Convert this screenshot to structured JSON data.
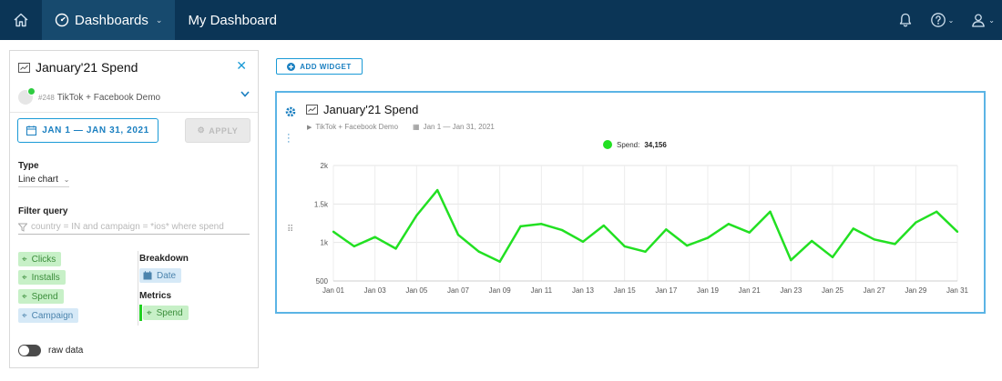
{
  "nav": {
    "dashboards_label": "Dashboards",
    "page_title": "My Dashboard"
  },
  "panel": {
    "title": "January'21 Spend",
    "source_id": "#248",
    "source_name": "TikTok + Facebook Demo",
    "date_range": "JAN 1 — JAN 31, 2021",
    "apply_label": "APPLY",
    "type_label": "Type",
    "type_value": "Line chart",
    "filter_label": "Filter query",
    "filter_placeholder": "country = IN and campaign = *ios* where spend",
    "fields": [
      {
        "label": "Clicks",
        "kind": "metric"
      },
      {
        "label": "Installs",
        "kind": "metric"
      },
      {
        "label": "Spend",
        "kind": "metric"
      },
      {
        "label": "Campaign",
        "kind": "dimension"
      }
    ],
    "breakdown_label": "Breakdown",
    "breakdown_value": "Date",
    "metrics_label": "Metrics",
    "metrics_value": "Spend",
    "raw_data_label": "raw data"
  },
  "toolbar": {
    "add_widget_label": "ADD WIDGET"
  },
  "widget": {
    "title": "January'21 Spend",
    "source": "TikTok + Facebook Demo",
    "date_range": "Jan 1 — Jan 31, 2021",
    "legend_label": "Spend:",
    "legend_total": "34,156"
  },
  "colors": {
    "series": "#22e022",
    "accent": "#1a9ad6",
    "nav_bg": "#0b3556"
  },
  "chart_data": {
    "type": "line",
    "x": [
      "Jan 01",
      "Jan 02",
      "Jan 03",
      "Jan 04",
      "Jan 05",
      "Jan 06",
      "Jan 07",
      "Jan 08",
      "Jan 09",
      "Jan 10",
      "Jan 11",
      "Jan 12",
      "Jan 13",
      "Jan 14",
      "Jan 15",
      "Jan 16",
      "Jan 17",
      "Jan 18",
      "Jan 19",
      "Jan 20",
      "Jan 21",
      "Jan 22",
      "Jan 23",
      "Jan 24",
      "Jan 25",
      "Jan 26",
      "Jan 27",
      "Jan 28",
      "Jan 29",
      "Jan 30",
      "Jan 31"
    ],
    "x_tick_labels": [
      "Jan 01",
      "Jan 03",
      "Jan 05",
      "Jan 07",
      "Jan 09",
      "Jan 11",
      "Jan 13",
      "Jan 15",
      "Jan 17",
      "Jan 19",
      "Jan 21",
      "Jan 23",
      "Jan 25",
      "Jan 27",
      "Jan 29",
      "Jan 31"
    ],
    "series": [
      {
        "name": "Spend",
        "values": [
          1140,
          950,
          1070,
          920,
          1350,
          1680,
          1100,
          880,
          750,
          1210,
          1240,
          1160,
          1010,
          1220,
          950,
          880,
          1170,
          960,
          1060,
          1240,
          1130,
          1400,
          770,
          1020,
          810,
          1180,
          1040,
          980,
          1260,
          1400,
          1140
        ]
      }
    ],
    "ylim": [
      500,
      2000
    ],
    "y_ticks": [
      500,
      1000,
      1500,
      2000
    ],
    "y_tick_labels": [
      "500",
      "1k",
      "1.5k",
      "2k"
    ],
    "grid": true,
    "xlabel": "",
    "ylabel": ""
  }
}
